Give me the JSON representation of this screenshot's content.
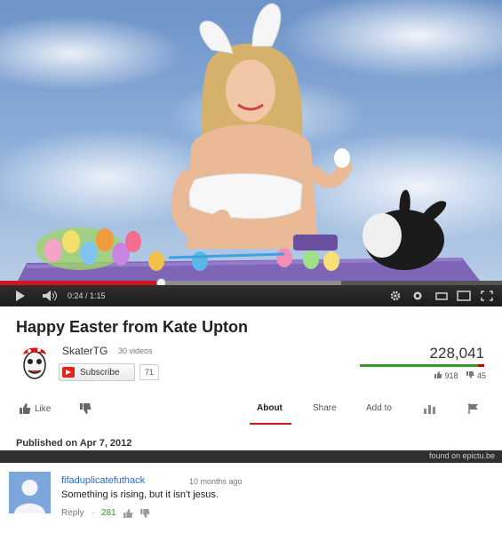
{
  "player": {
    "time_display": "0:24 / 1:15",
    "played_fraction": 0.32,
    "buffered_fraction": 0.68,
    "icons": [
      "play-icon",
      "volume-icon",
      "settings-gear-icon",
      "annotations-icon",
      "small-player-icon",
      "large-player-icon",
      "fullscreen-icon"
    ]
  },
  "video": {
    "title": "Happy Easter from Kate Upton",
    "views": "228,041",
    "likes": "918",
    "dislikes": "45",
    "like_ratio": 0.953
  },
  "channel": {
    "name": "SkaterTG",
    "videos_count": "30 videos",
    "subscribe_label": "Subscribe",
    "subscriber_count": "71"
  },
  "actions": {
    "like_label": "Like",
    "about_label": "About",
    "share_label": "Share",
    "add_to_label": "Add to"
  },
  "description": {
    "published": "Published on Apr 7, 2012"
  },
  "watermark": "found on epictu.be",
  "comment": {
    "author": "fifaduplicatefuthack",
    "time": "10 months ago",
    "text": "Something is rising, but it isn't jesus.",
    "reply_label": "Reply",
    "separator": "·",
    "likes": "281"
  },
  "colors": {
    "accent_red": "#cc181e",
    "like_green": "#2d9e1f",
    "link_blue": "#2a6ac7"
  }
}
